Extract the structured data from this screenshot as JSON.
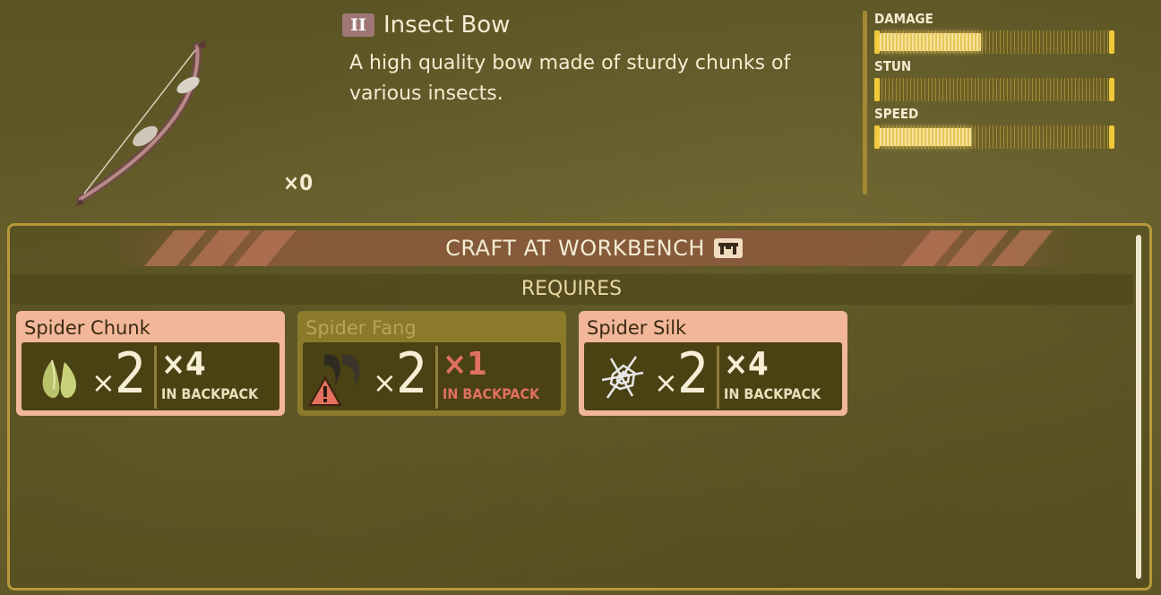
{
  "item": {
    "tier": "II",
    "name": "Insect Bow",
    "description": "A high quality bow made of sturdy chunks of various insects.",
    "count": "×0",
    "art": "bow-icon"
  },
  "stats": [
    {
      "label": "DAMAGE",
      "level": 0.44
    },
    {
      "label": "STUN",
      "level": 0.0
    },
    {
      "label": "SPEED",
      "level": 0.4
    }
  ],
  "craft": {
    "location_label": "CRAFT AT WORKBENCH",
    "location_icon": "workbench-icon",
    "requires_label": "REQUIRES"
  },
  "ingredients": [
    {
      "name": "Spider Chunk",
      "icon": "spider-chunk-icon",
      "need_x": "×",
      "need": "2",
      "have": "×4",
      "have_label": "IN BACKPACK",
      "sufficient": true
    },
    {
      "name": "Spider Fang",
      "icon": "spider-fang-icon",
      "need_x": "×",
      "need": "2",
      "have": "×1",
      "have_label": "IN BACKPACK",
      "sufficient": false,
      "status_icon": "warning-icon"
    },
    {
      "name": "Spider Silk",
      "icon": "spider-silk-icon",
      "need_x": "×",
      "need": "2",
      "have": "×4",
      "have_label": "IN BACKPACK",
      "sufficient": true
    }
  ],
  "colors": {
    "accent": "#f0c93a",
    "card_ok": "#f2b79a",
    "card_warn": "#8a7a2a",
    "insufficient_text": "#e07060"
  }
}
